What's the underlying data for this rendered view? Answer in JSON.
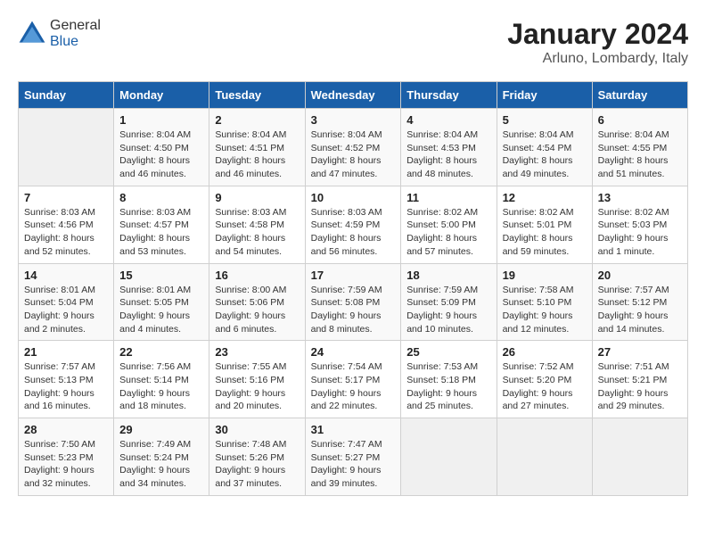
{
  "logo": {
    "general": "General",
    "blue": "Blue"
  },
  "title": "January 2024",
  "subtitle": "Arluno, Lombardy, Italy",
  "days_of_week": [
    "Sunday",
    "Monday",
    "Tuesday",
    "Wednesday",
    "Thursday",
    "Friday",
    "Saturday"
  ],
  "weeks": [
    [
      {
        "day": "",
        "empty": true
      },
      {
        "day": "1",
        "sunrise": "Sunrise: 8:04 AM",
        "sunset": "Sunset: 4:50 PM",
        "daylight": "Daylight: 8 hours and 46 minutes."
      },
      {
        "day": "2",
        "sunrise": "Sunrise: 8:04 AM",
        "sunset": "Sunset: 4:51 PM",
        "daylight": "Daylight: 8 hours and 46 minutes."
      },
      {
        "day": "3",
        "sunrise": "Sunrise: 8:04 AM",
        "sunset": "Sunset: 4:52 PM",
        "daylight": "Daylight: 8 hours and 47 minutes."
      },
      {
        "day": "4",
        "sunrise": "Sunrise: 8:04 AM",
        "sunset": "Sunset: 4:53 PM",
        "daylight": "Daylight: 8 hours and 48 minutes."
      },
      {
        "day": "5",
        "sunrise": "Sunrise: 8:04 AM",
        "sunset": "Sunset: 4:54 PM",
        "daylight": "Daylight: 8 hours and 49 minutes."
      },
      {
        "day": "6",
        "sunrise": "Sunrise: 8:04 AM",
        "sunset": "Sunset: 4:55 PM",
        "daylight": "Daylight: 8 hours and 51 minutes."
      }
    ],
    [
      {
        "day": "7",
        "sunrise": "Sunrise: 8:03 AM",
        "sunset": "Sunset: 4:56 PM",
        "daylight": "Daylight: 8 hours and 52 minutes."
      },
      {
        "day": "8",
        "sunrise": "Sunrise: 8:03 AM",
        "sunset": "Sunset: 4:57 PM",
        "daylight": "Daylight: 8 hours and 53 minutes."
      },
      {
        "day": "9",
        "sunrise": "Sunrise: 8:03 AM",
        "sunset": "Sunset: 4:58 PM",
        "daylight": "Daylight: 8 hours and 54 minutes."
      },
      {
        "day": "10",
        "sunrise": "Sunrise: 8:03 AM",
        "sunset": "Sunset: 4:59 PM",
        "daylight": "Daylight: 8 hours and 56 minutes."
      },
      {
        "day": "11",
        "sunrise": "Sunrise: 8:02 AM",
        "sunset": "Sunset: 5:00 PM",
        "daylight": "Daylight: 8 hours and 57 minutes."
      },
      {
        "day": "12",
        "sunrise": "Sunrise: 8:02 AM",
        "sunset": "Sunset: 5:01 PM",
        "daylight": "Daylight: 8 hours and 59 minutes."
      },
      {
        "day": "13",
        "sunrise": "Sunrise: 8:02 AM",
        "sunset": "Sunset: 5:03 PM",
        "daylight": "Daylight: 9 hours and 1 minute."
      }
    ],
    [
      {
        "day": "14",
        "sunrise": "Sunrise: 8:01 AM",
        "sunset": "Sunset: 5:04 PM",
        "daylight": "Daylight: 9 hours and 2 minutes."
      },
      {
        "day": "15",
        "sunrise": "Sunrise: 8:01 AM",
        "sunset": "Sunset: 5:05 PM",
        "daylight": "Daylight: 9 hours and 4 minutes."
      },
      {
        "day": "16",
        "sunrise": "Sunrise: 8:00 AM",
        "sunset": "Sunset: 5:06 PM",
        "daylight": "Daylight: 9 hours and 6 minutes."
      },
      {
        "day": "17",
        "sunrise": "Sunrise: 7:59 AM",
        "sunset": "Sunset: 5:08 PM",
        "daylight": "Daylight: 9 hours and 8 minutes."
      },
      {
        "day": "18",
        "sunrise": "Sunrise: 7:59 AM",
        "sunset": "Sunset: 5:09 PM",
        "daylight": "Daylight: 9 hours and 10 minutes."
      },
      {
        "day": "19",
        "sunrise": "Sunrise: 7:58 AM",
        "sunset": "Sunset: 5:10 PM",
        "daylight": "Daylight: 9 hours and 12 minutes."
      },
      {
        "day": "20",
        "sunrise": "Sunrise: 7:57 AM",
        "sunset": "Sunset: 5:12 PM",
        "daylight": "Daylight: 9 hours and 14 minutes."
      }
    ],
    [
      {
        "day": "21",
        "sunrise": "Sunrise: 7:57 AM",
        "sunset": "Sunset: 5:13 PM",
        "daylight": "Daylight: 9 hours and 16 minutes."
      },
      {
        "day": "22",
        "sunrise": "Sunrise: 7:56 AM",
        "sunset": "Sunset: 5:14 PM",
        "daylight": "Daylight: 9 hours and 18 minutes."
      },
      {
        "day": "23",
        "sunrise": "Sunrise: 7:55 AM",
        "sunset": "Sunset: 5:16 PM",
        "daylight": "Daylight: 9 hours and 20 minutes."
      },
      {
        "day": "24",
        "sunrise": "Sunrise: 7:54 AM",
        "sunset": "Sunset: 5:17 PM",
        "daylight": "Daylight: 9 hours and 22 minutes."
      },
      {
        "day": "25",
        "sunrise": "Sunrise: 7:53 AM",
        "sunset": "Sunset: 5:18 PM",
        "daylight": "Daylight: 9 hours and 25 minutes."
      },
      {
        "day": "26",
        "sunrise": "Sunrise: 7:52 AM",
        "sunset": "Sunset: 5:20 PM",
        "daylight": "Daylight: 9 hours and 27 minutes."
      },
      {
        "day": "27",
        "sunrise": "Sunrise: 7:51 AM",
        "sunset": "Sunset: 5:21 PM",
        "daylight": "Daylight: 9 hours and 29 minutes."
      }
    ],
    [
      {
        "day": "28",
        "sunrise": "Sunrise: 7:50 AM",
        "sunset": "Sunset: 5:23 PM",
        "daylight": "Daylight: 9 hours and 32 minutes."
      },
      {
        "day": "29",
        "sunrise": "Sunrise: 7:49 AM",
        "sunset": "Sunset: 5:24 PM",
        "daylight": "Daylight: 9 hours and 34 minutes."
      },
      {
        "day": "30",
        "sunrise": "Sunrise: 7:48 AM",
        "sunset": "Sunset: 5:26 PM",
        "daylight": "Daylight: 9 hours and 37 minutes."
      },
      {
        "day": "31",
        "sunrise": "Sunrise: 7:47 AM",
        "sunset": "Sunset: 5:27 PM",
        "daylight": "Daylight: 9 hours and 39 minutes."
      },
      {
        "day": "",
        "empty": true
      },
      {
        "day": "",
        "empty": true
      },
      {
        "day": "",
        "empty": true
      }
    ]
  ]
}
